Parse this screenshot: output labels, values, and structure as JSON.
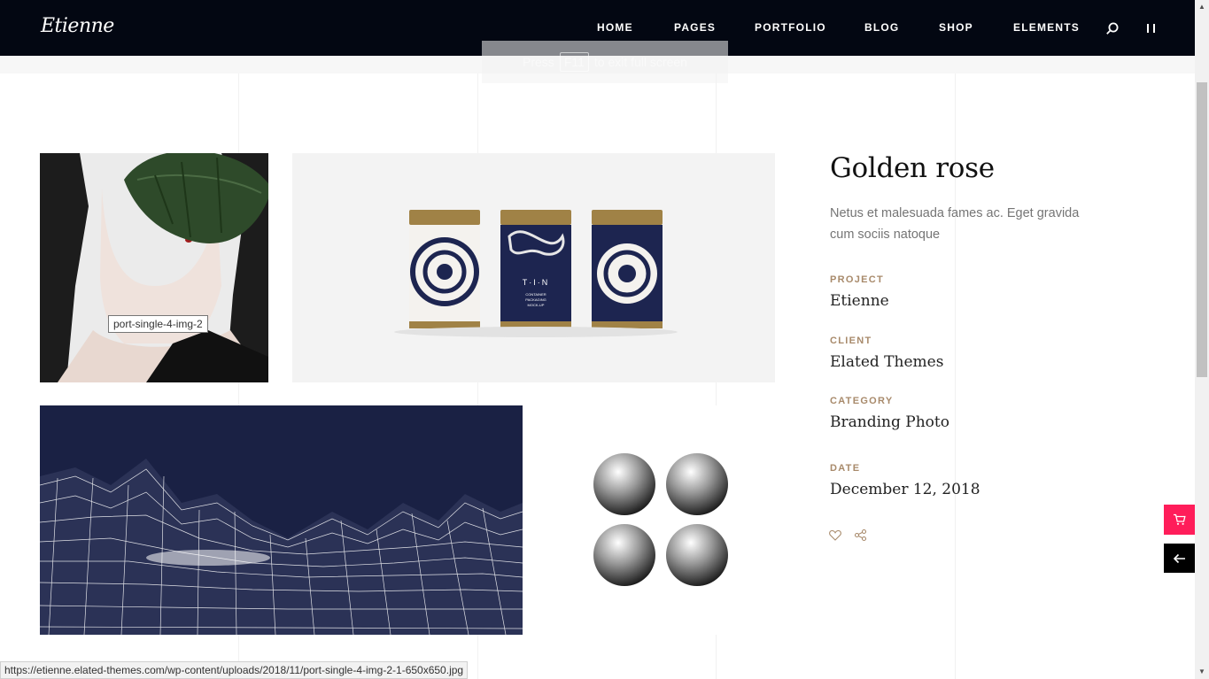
{
  "header": {
    "logo": "Etienne",
    "nav": [
      "HOME",
      "PAGES",
      "PORTFOLIO",
      "BLOG",
      "SHOP",
      "ELEMENTS"
    ]
  },
  "fullscreen_notice": {
    "before": "Press",
    "key": "F11",
    "after": "to exit full screen"
  },
  "gallery": {
    "hover_tooltip": "port-single-4-img-2",
    "tin_label": "T·I·N",
    "tin_sub": "CONTAINER\nPACKAGING\nMOCK-UP"
  },
  "project": {
    "title": "Golden rose",
    "description": "Netus et malesuada fames ac. Eget gravida cum sociis natoque",
    "meta": [
      {
        "label": "PROJECT",
        "value": "Etienne"
      },
      {
        "label": "CLIENT",
        "value": "Elated Themes"
      },
      {
        "label": "CATEGORY",
        "value": "Branding Photo"
      },
      {
        "label": "DATE",
        "value": "December 12, 2018"
      }
    ]
  },
  "status_bar": "https://etienne.elated-themes.com/wp-content/uploads/2018/11/port-single-4-img-2-1-650x650.jpg",
  "colors": {
    "header_bg": "#030712",
    "accent_label": "#a88a6b",
    "cart_button": "#ff1d5a",
    "navy": "#1a2144"
  },
  "icons": [
    "search-icon",
    "menu-icon",
    "heart-icon",
    "share-icon",
    "cart-icon",
    "arrow-left-icon"
  ]
}
